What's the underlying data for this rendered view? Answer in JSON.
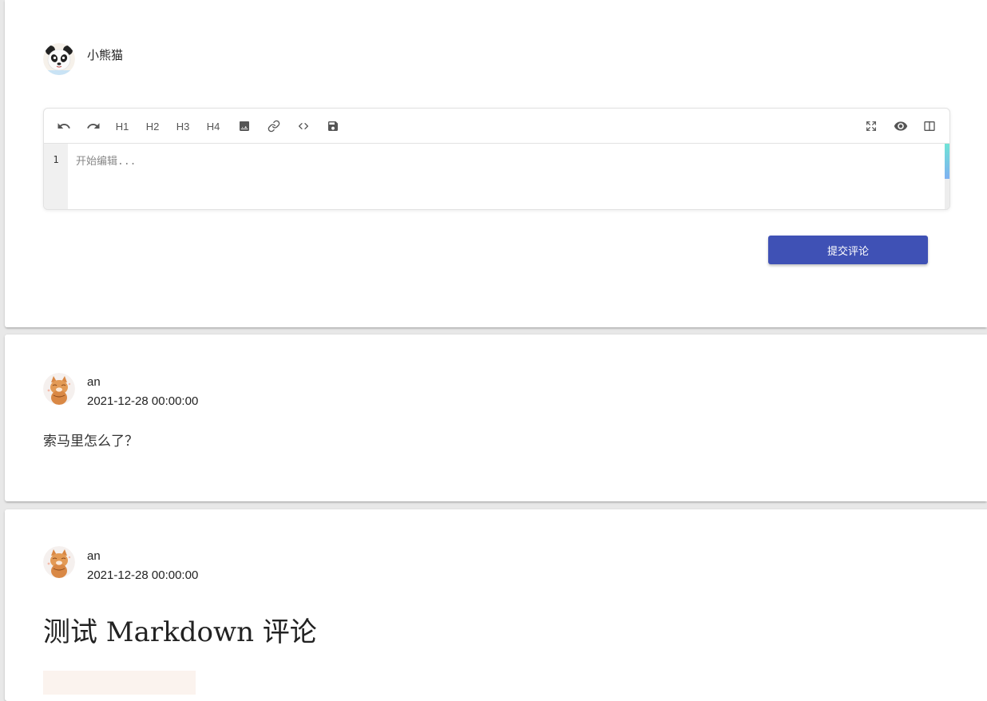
{
  "composer": {
    "user_name": "小熊猫",
    "editor": {
      "toolbar_left": [
        {
          "name": "undo-icon",
          "label": ""
        },
        {
          "name": "redo-icon",
          "label": ""
        },
        {
          "name": "h1-button",
          "label": "H1"
        },
        {
          "name": "h2-button",
          "label": "H2"
        },
        {
          "name": "h3-button",
          "label": "H3"
        },
        {
          "name": "h4-button",
          "label": "H4"
        },
        {
          "name": "image-icon",
          "label": ""
        },
        {
          "name": "link-icon",
          "label": ""
        },
        {
          "name": "code-icon",
          "label": ""
        },
        {
          "name": "save-icon",
          "label": ""
        }
      ],
      "toolbar_right": [
        {
          "name": "fullscreen-icon",
          "label": ""
        },
        {
          "name": "preview-icon",
          "label": ""
        },
        {
          "name": "split-view-icon",
          "label": ""
        }
      ],
      "line_number": "1",
      "placeholder": "开始编辑..."
    },
    "submit_label": "提交评论",
    "accent_color": "#3f51b5"
  },
  "comments": [
    {
      "user_name": "an",
      "date": "2021-12-28 00:00:00",
      "content": "索马里怎么了？"
    },
    {
      "user_name": "an",
      "date": "2021-12-28 00:00:00",
      "heading": "测试 Markdown 评论"
    }
  ]
}
